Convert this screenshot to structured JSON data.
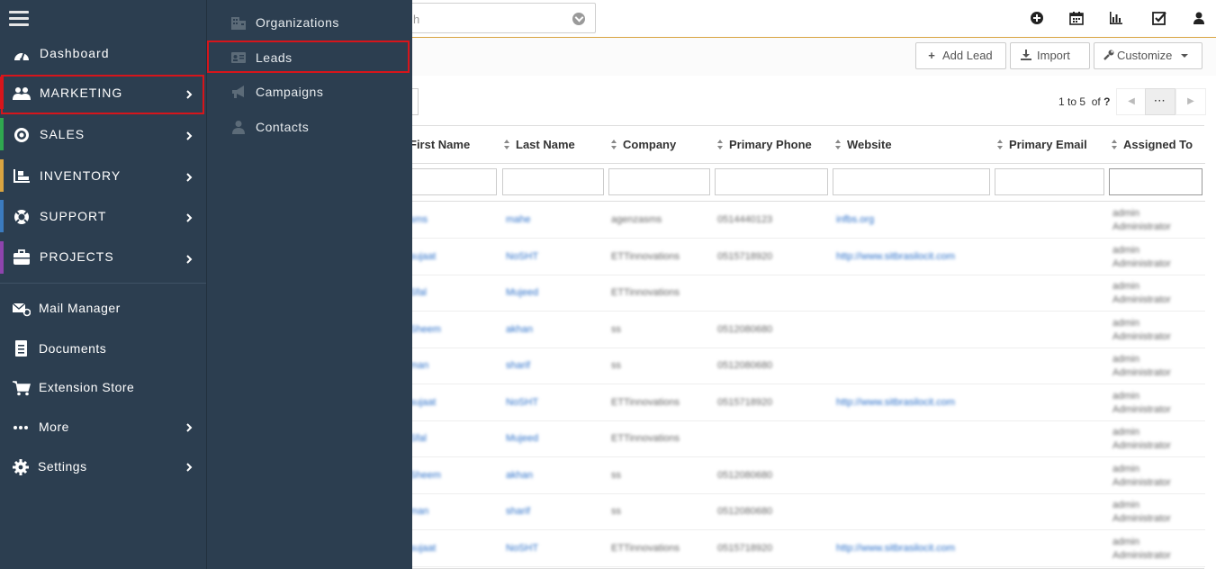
{
  "header": {
    "search_placeholder": "h"
  },
  "sidebar": {
    "items": [
      {
        "key": "dashboard",
        "label": "Dashboard"
      },
      {
        "key": "marketing",
        "label": "MARKETING"
      },
      {
        "key": "sales",
        "label": "SALES"
      },
      {
        "key": "inventory",
        "label": "INVENTORY"
      },
      {
        "key": "support",
        "label": "SUPPORT"
      },
      {
        "key": "projects",
        "label": "PROJECTS"
      },
      {
        "key": "mail",
        "label": "Mail Manager"
      },
      {
        "key": "documents",
        "label": "Documents"
      },
      {
        "key": "store",
        "label": "Extension Store"
      },
      {
        "key": "more",
        "label": "More"
      },
      {
        "key": "settings",
        "label": "Settings"
      }
    ],
    "accent_colors": {
      "marketing": "#d7151b",
      "sales": "#2fa84f",
      "inventory": "#d9a441",
      "support": "#3b7bbf",
      "projects": "#8e44ad"
    }
  },
  "submenu": {
    "items": [
      {
        "label": "Organizations",
        "icon": "building-icon"
      },
      {
        "label": "Leads",
        "icon": "id-card-icon"
      },
      {
        "label": "Campaigns",
        "icon": "megaphone-icon"
      },
      {
        "label": "Contacts",
        "icon": "user-icon"
      }
    ]
  },
  "toolbar": {
    "add_lead": "Add Lead",
    "import": "Import",
    "customize": "Customize"
  },
  "pager": {
    "range": "1 to 5",
    "of": "of",
    "total": "?",
    "more": "···"
  },
  "table": {
    "columns": [
      "First Name",
      "Last Name",
      "Company",
      "Primary Phone",
      "Website",
      "Primary Email",
      "Assigned To"
    ],
    "rows": [
      [
        "sms",
        "mahe",
        "agenzasms",
        "0514440123",
        "infbs.org",
        "",
        "admin Administrator"
      ],
      [
        "sujaat",
        "NoSHT",
        "ETTinnovations",
        "0515718920",
        "http://www.sitbrasilocit.com",
        "",
        "admin Administrator"
      ],
      [
        "Sfal",
        "Mujeed",
        "ETTinnovations",
        "",
        "",
        "",
        "admin Administrator"
      ],
      [
        "Sheem",
        "akhan",
        "ss",
        "0512080680",
        "",
        "",
        "admin Administrator"
      ],
      [
        "man",
        "sharif",
        "ss",
        "0512080680",
        "",
        "",
        "admin Administrator"
      ],
      [
        "sujaat",
        "NoSHT",
        "ETTinnovations",
        "0515718920",
        "http://www.sitbrasilocit.com",
        "",
        "admin Administrator"
      ],
      [
        "Sfal",
        "Mujeed",
        "ETTinnovations",
        "",
        "",
        "",
        "admin Administrator"
      ],
      [
        "Sheem",
        "akhan",
        "ss",
        "0512080680",
        "",
        "",
        "admin Administrator"
      ],
      [
        "man",
        "sharif",
        "ss",
        "0512080680",
        "",
        "",
        "admin Administrator"
      ],
      [
        "sujaat",
        "NoSHT",
        "ETTinnovations",
        "0515718920",
        "http://www.sitbrasilocit.com",
        "",
        "admin Administrator"
      ]
    ]
  }
}
